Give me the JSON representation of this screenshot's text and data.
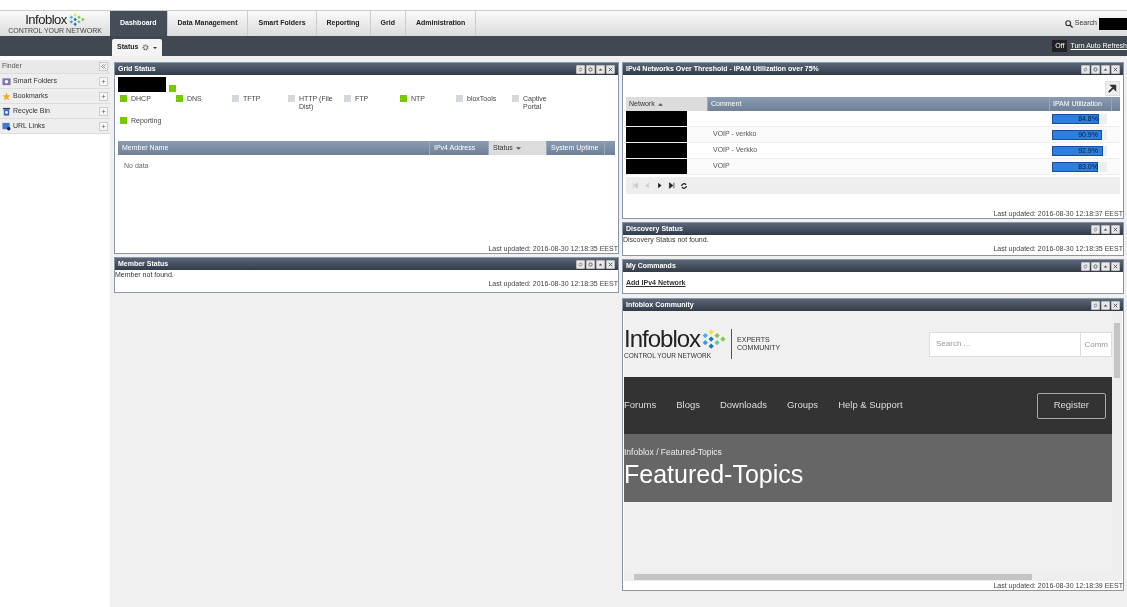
{
  "header": {
    "logo": {
      "name": "Infoblox",
      "tagline": "CONTROL YOUR NETWORK"
    },
    "tabs": [
      {
        "label": "Dashboard",
        "selected": true
      },
      {
        "label": "Data Management",
        "selected": false
      },
      {
        "label": "Smart Folders",
        "selected": false
      },
      {
        "label": "Reporting",
        "selected": false
      },
      {
        "label": "Grid",
        "selected": false
      },
      {
        "label": "Administration",
        "selected": false
      }
    ],
    "search_label": "Search"
  },
  "subbar": {
    "tabs": [
      {
        "label": "Status",
        "selected": true
      }
    ],
    "auto_refresh": {
      "state": "Off",
      "link": "Turn Auto Refresh"
    }
  },
  "finder": {
    "title": "Finder",
    "items": [
      {
        "label": "Smart Folders",
        "kind": "folder"
      },
      {
        "label": "Bookmarks",
        "kind": "star"
      },
      {
        "label": "Recycle Bin",
        "kind": "bin"
      },
      {
        "label": "URL Links",
        "kind": "link"
      }
    ]
  },
  "grid_status": {
    "title": "Grid Status",
    "services": [
      {
        "label": "DHCP",
        "on": true
      },
      {
        "label": "DNS",
        "on": true
      },
      {
        "label": "TFTP",
        "on": false
      },
      {
        "label": "HTTP (File Dist)",
        "on": false
      },
      {
        "label": "FTP",
        "on": false
      },
      {
        "label": "NTP",
        "on": true
      },
      {
        "label": "bloxTools",
        "on": false
      },
      {
        "label": "Captive Portal",
        "on": false
      },
      {
        "label": "Reporting",
        "on": true
      }
    ],
    "columns": [
      {
        "label": "Member Name",
        "sorted": false
      },
      {
        "label": "IPv4 Address",
        "sorted": false
      },
      {
        "label": "Status",
        "sorted": true
      },
      {
        "label": "System Uptime",
        "sorted": false
      }
    ],
    "empty": "No data",
    "updated": "Last updated: 2016-08-30 12:18:35 EEST"
  },
  "member_status": {
    "title": "Member Status",
    "message": "Member not found.",
    "updated": "Last updated: 2016-08-30 12:18:35 EEST"
  },
  "ipv4_networks": {
    "title": "IPv4 Networks Over Threshold - IPAM Utilization over 75%",
    "columns": [
      {
        "label": "Network",
        "sorted": true
      },
      {
        "label": "Comment",
        "sorted": false
      },
      {
        "label": "IPAM Utilization",
        "sorted": false
      }
    ],
    "rows": [
      {
        "comment": "",
        "level": 0.848,
        "reading": "84.8%"
      },
      {
        "comment": "VOIP - verkko",
        "level": 0.909,
        "reading": "90.9%"
      },
      {
        "comment": "VOIP - Verkko",
        "level": 0.929,
        "reading": "92.9%"
      },
      {
        "comment": "VOIP",
        "level": 0.83,
        "reading": "83.0%"
      }
    ],
    "updated": "Last updated: 2016-08-30 12:18:37 EEST"
  },
  "discovery_status": {
    "title": "Discovery Status",
    "message": "Discovery Status not found.",
    "updated": "Last updated: 2016-08-30 12:18:35 EEST"
  },
  "my_commands": {
    "title": "My Commands",
    "links": [
      "Add IPv4 Network"
    ]
  },
  "community": {
    "title": "Infoblox Community",
    "site": {
      "logo": "Infoblox",
      "tagline": "CONTROL YOUR NETWORK",
      "sub": [
        "EXPERTS",
        "COMMUNITY"
      ],
      "search_placeholder": "Search ...",
      "search_button": "Comm",
      "nav": [
        "Forums",
        "Blogs",
        "Downloads",
        "Groups",
        "Help & Support"
      ],
      "register": "Register",
      "breadcrumb": "Infoblox / Featured-Topics",
      "heading": "Featured-Topics"
    },
    "updated": "Last updated: 2016-08-30 12:18:39 EEST"
  }
}
